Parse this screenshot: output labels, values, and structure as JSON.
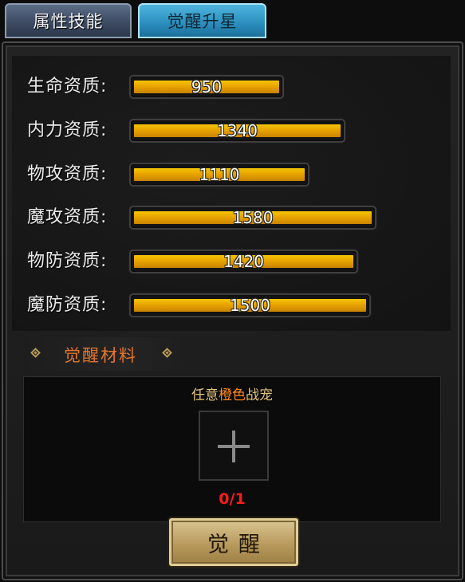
{
  "tabs": [
    {
      "label": "属性技能",
      "active": false
    },
    {
      "label": "觉醒升星",
      "active": true
    }
  ],
  "stats": [
    {
      "label": "生命资质:",
      "value": "950",
      "fill": 0.6
    },
    {
      "label": "内力资质:",
      "value": "1340",
      "fill": 0.85
    },
    {
      "label": "物攻资质:",
      "value": "1110",
      "fill": 0.7
    },
    {
      "label": "魔攻资质:",
      "value": "1580",
      "fill": 1.0
    },
    {
      "label": "物防资质:",
      "value": "1420",
      "fill": 0.9
    },
    {
      "label": "魔防资质:",
      "value": "1500",
      "fill": 0.95
    }
  ],
  "material_section": {
    "title": "觉醒材料",
    "requirement_prefix": "任意",
    "requirement_highlight": "橙色",
    "requirement_suffix": "战宠",
    "count": "0/1",
    "slot_icon": "plus-icon"
  },
  "action": {
    "label": "觉醒"
  },
  "colors": {
    "bar_fill": "#f0b400",
    "section_title": "#e4762a",
    "highlight": "#ff8a1e",
    "count": "#ff1a1a",
    "active_tab": "#2a8dbd"
  }
}
